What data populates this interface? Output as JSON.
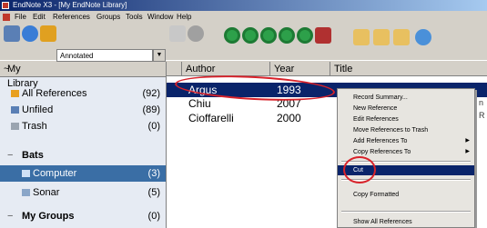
{
  "window": {
    "title": "EndNote X3 - [My EndNote Library]"
  },
  "menubar": {
    "items": [
      "File",
      "Edit",
      "References",
      "Groups",
      "Tools",
      "Window",
      "Help"
    ]
  },
  "toolbar": {
    "style_value": "Annotated"
  },
  "library": {
    "header": "My Library",
    "header_caret": "~",
    "rows": [
      {
        "label": "All References",
        "count": "(92)"
      },
      {
        "label": "Unfiled",
        "count": "(89)"
      },
      {
        "label": "Trash",
        "count": "(0)"
      }
    ],
    "group_sets": [
      {
        "label": "Bats",
        "twisty": "−",
        "groups": [
          {
            "label": "Computer",
            "count": "(3)"
          },
          {
            "label": "Sonar",
            "count": "(5)"
          }
        ]
      },
      {
        "label": "My Groups",
        "twisty": "−",
        "count": "(0)"
      }
    ]
  },
  "references": {
    "columns": [
      "",
      "Author",
      "Year",
      "Title"
    ],
    "rows": [
      {
        "author": "Argus",
        "year": "1993"
      },
      {
        "author": "Chiu",
        "year": "2007"
      },
      {
        "author": "Cioffarelli",
        "year": "2000"
      }
    ],
    "behind_text": [
      "n",
      "R"
    ]
  },
  "context_menu": {
    "items": [
      {
        "label": "Record Summary..."
      },
      {
        "label": "New Reference"
      },
      {
        "label": "Edit References"
      },
      {
        "label": "Move References to Trash"
      },
      {
        "label": "Add References To",
        "submenu": true
      },
      {
        "label": "Copy References To",
        "submenu": true
      },
      {
        "label": "Cut",
        "highlighted": true
      },
      {
        "label": "Copy Formatted"
      },
      {
        "label": "Show All References"
      }
    ],
    "submenu_arrow": "▶"
  },
  "annotation_color": "#d8222a"
}
